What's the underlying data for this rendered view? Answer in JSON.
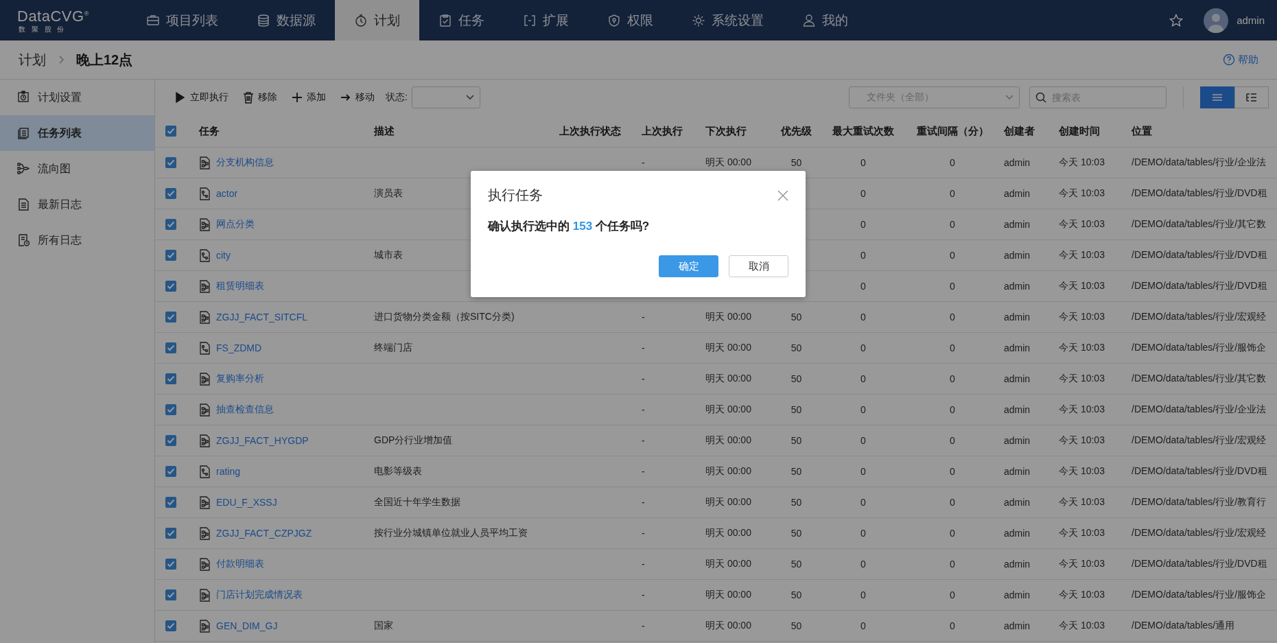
{
  "nav": {
    "logo": {
      "text": "DataCVG",
      "mark": "®",
      "subtitle": "数 聚 股 份"
    },
    "items": [
      {
        "label": "项目列表",
        "selected": false
      },
      {
        "label": "数据源",
        "selected": false
      },
      {
        "label": "计划",
        "selected": true
      },
      {
        "label": "任务",
        "selected": false
      },
      {
        "label": "扩展",
        "selected": false
      },
      {
        "label": "权限",
        "selected": false
      },
      {
        "label": "系统设置",
        "selected": false
      },
      {
        "label": "我的",
        "selected": false
      }
    ],
    "user": "admin"
  },
  "breadcrumb": {
    "items": [
      "计划",
      "晚上12点"
    ],
    "help": "帮助"
  },
  "sidebar": {
    "items": [
      {
        "label": "计划设置",
        "selected": false
      },
      {
        "label": "任务列表",
        "selected": true
      },
      {
        "label": "流向图",
        "selected": false
      },
      {
        "label": "最新日志",
        "selected": false
      },
      {
        "label": "所有日志",
        "selected": false
      }
    ]
  },
  "toolbar": {
    "actions": [
      "立即执行",
      "移除",
      "添加",
      "移动"
    ],
    "status_label": "状态:",
    "folder_placeholder": "文件夹（全部）",
    "search_placeholder": "搜索表",
    "views": [
      {
        "selected": true
      },
      {
        "selected": false
      }
    ]
  },
  "table": {
    "all_checked": true,
    "columns": [
      "任务",
      "描述",
      "上次执行状态",
      "上次执行",
      "下次执行",
      "优先级",
      "最大重试次数",
      "重试间隔（分）",
      "创建者",
      "创建时间",
      "位置"
    ],
    "rows": [
      {
        "checked": true,
        "kind": "flow",
        "task": "分支机构信息",
        "last_run": "-",
        "next_run": "明天 00:00",
        "priority": "50",
        "max_retries": "0",
        "retry_interval": "0",
        "creator": "admin",
        "created": "今天 10:03",
        "location": "/DEMO/data/tables/行业/企业法"
      },
      {
        "checked": true,
        "kind": "script",
        "task": "actor",
        "description": "演员表",
        "max_retries": "0",
        "retry_interval": "0",
        "creator": "admin",
        "created": "今天 10:03",
        "location": "/DEMO/data/tables/行业/DVD租"
      },
      {
        "checked": true,
        "kind": "flow",
        "task": "网点分类",
        "max_retries": "0",
        "retry_interval": "0",
        "creator": "admin",
        "created": "今天 10:03",
        "location": "/DEMO/data/tables/行业/其它数"
      },
      {
        "checked": true,
        "kind": "script",
        "task": "city",
        "description": "城市表",
        "max_retries": "0",
        "retry_interval": "0",
        "creator": "admin",
        "created": "今天 10:03",
        "location": "/DEMO/data/tables/行业/DVD租"
      },
      {
        "checked": true,
        "kind": "flow",
        "task": "租赁明细表",
        "max_retries": "0",
        "retry_interval": "0",
        "creator": "admin",
        "created": "今天 10:03",
        "location": "/DEMO/data/tables/行业/DVD租"
      },
      {
        "checked": true,
        "kind": "flow",
        "task": "ZGJJ_FACT_SITCFL",
        "description": "进口货物分类金额（按SITC分类)",
        "last_run": "-",
        "next_run": "明天 00:00",
        "priority": "50",
        "max_retries": "0",
        "retry_interval": "0",
        "creator": "admin",
        "created": "今天 10:03",
        "location": "/DEMO/data/tables/行业/宏观经"
      },
      {
        "checked": true,
        "kind": "script",
        "task": "FS_ZDMD",
        "description": "终端门店",
        "last_run": "-",
        "next_run": "明天 00:00",
        "priority": "50",
        "max_retries": "0",
        "retry_interval": "0",
        "creator": "admin",
        "created": "今天 10:03",
        "location": "/DEMO/data/tables/行业/服饰企"
      },
      {
        "checked": true,
        "kind": "flow",
        "task": "复购率分析",
        "last_run": "-",
        "next_run": "明天 00:00",
        "priority": "50",
        "max_retries": "0",
        "retry_interval": "0",
        "creator": "admin",
        "created": "今天 10:03",
        "location": "/DEMO/data/tables/行业/其它数"
      },
      {
        "checked": true,
        "kind": "flow",
        "task": "抽查检查信息",
        "last_run": "-",
        "next_run": "明天 00:00",
        "priority": "50",
        "max_retries": "0",
        "retry_interval": "0",
        "creator": "admin",
        "created": "今天 10:03",
        "location": "/DEMO/data/tables/行业/企业法"
      },
      {
        "checked": true,
        "kind": "flow",
        "task": "ZGJJ_FACT_HYGDP",
        "description": "GDP分行业增加值",
        "last_run": "-",
        "next_run": "明天 00:00",
        "priority": "50",
        "max_retries": "0",
        "retry_interval": "0",
        "creator": "admin",
        "created": "今天 10:03",
        "location": "/DEMO/data/tables/行业/宏观经"
      },
      {
        "checked": true,
        "kind": "script",
        "task": "rating",
        "description": "电影等级表",
        "last_run": "-",
        "next_run": "明天 00:00",
        "priority": "50",
        "max_retries": "0",
        "retry_interval": "0",
        "creator": "admin",
        "created": "今天 10:03",
        "location": "/DEMO/data/tables/行业/DVD租"
      },
      {
        "checked": true,
        "kind": "flow",
        "task": "EDU_F_XSSJ",
        "description": "全国近十年学生数据",
        "last_run": "-",
        "next_run": "明天 00:00",
        "priority": "50",
        "max_retries": "0",
        "retry_interval": "0",
        "creator": "admin",
        "created": "今天 10:03",
        "location": "/DEMO/data/tables/行业/教育行"
      },
      {
        "checked": true,
        "kind": "flow",
        "task": "ZGJJ_FACT_CZPJGZ",
        "description": "按行业分城镇单位就业人员平均工资",
        "last_run": "-",
        "next_run": "明天 00:00",
        "priority": "50",
        "max_retries": "0",
        "retry_interval": "0",
        "creator": "admin",
        "created": "今天 10:03",
        "location": "/DEMO/data/tables/行业/宏观经"
      },
      {
        "checked": true,
        "kind": "flow",
        "task": "付款明细表",
        "last_run": "-",
        "next_run": "明天 00:00",
        "priority": "50",
        "max_retries": "0",
        "retry_interval": "0",
        "creator": "admin",
        "created": "今天 10:03",
        "location": "/DEMO/data/tables/行业/DVD租"
      },
      {
        "checked": true,
        "kind": "flow",
        "task": "门店计划完成情况表",
        "last_run": "-",
        "next_run": "明天 00:00",
        "priority": "50",
        "max_retries": "0",
        "retry_interval": "0",
        "creator": "admin",
        "created": "今天 10:03",
        "location": "/DEMO/data/tables/行业/服饰企"
      },
      {
        "checked": true,
        "kind": "flow",
        "task": "GEN_DIM_GJ",
        "description": "国家",
        "last_run": "-",
        "next_run": "明天 00:00",
        "priority": "50",
        "max_retries": "0",
        "retry_interval": "0",
        "creator": "admin",
        "created": "今天 10:03",
        "location": "/DEMO/data/tables/通用"
      }
    ]
  },
  "dialog": {
    "title": "执行任务",
    "message_before": "确认执行选中的",
    "count": "153",
    "message_after": "个任务吗?",
    "buttons": [
      {
        "label": "确定",
        "kind": "primary"
      },
      {
        "label": "取消",
        "kind": "default"
      }
    ]
  }
}
